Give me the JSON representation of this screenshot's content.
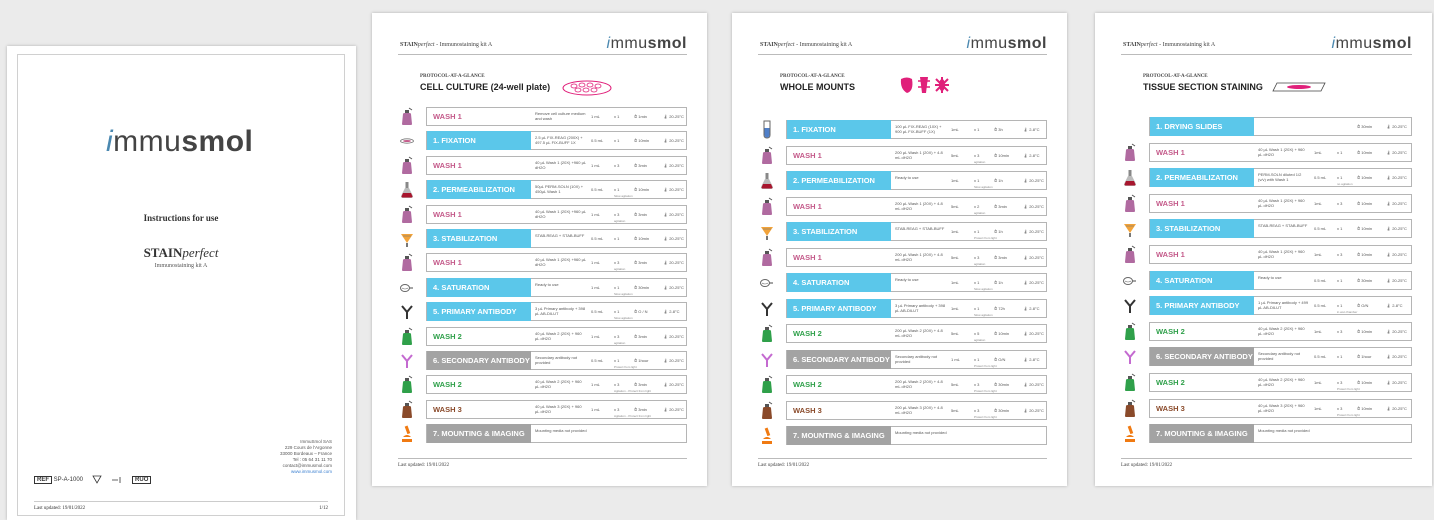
{
  "cover": {
    "logo_i": "i",
    "logo_mmu": "mmu",
    "logo_smol": "smol",
    "instructions": "Instructions for use",
    "brand_a": "STAIN",
    "brand_b": "perfect",
    "kit": "Immunostaining kit A",
    "address": [
      "ImmuSmol SAS",
      "229 Cours de l'Argonne",
      "33000 Bordeaux – France",
      "Tel : 05 64 31 11 70",
      "contact@immusmol.com",
      "www.immusmol.com"
    ],
    "ref_label": "REF",
    "ref_value": "SP-A-1000",
    "ruo": "RUO",
    "last_updated": "Last updated: 19/01/2022",
    "page_no": "1/12"
  },
  "header": {
    "brand_a": "STAIN",
    "brand_b": "perfect",
    "kit": " - Immunostaining kit A",
    "glance": "PROTOCOL-AT-A-GLANCE",
    "last_updated": "Last updated: 19/01/2022"
  },
  "page1": {
    "title": "CELL CULTURE (24-well plate)",
    "rows": [
      {
        "kind": "wash",
        "icon": "wash-bottle-icon",
        "label": "WASH 1",
        "reagent": "Remove cell culture medium and wash",
        "vol": "1 mL",
        "rep": "x 1",
        "time": "1min",
        "temp": "20-25°C",
        "note": ""
      },
      {
        "kind": "step",
        "icon": "petri-dish-icon",
        "label": "1. FIXATION",
        "reagent": "2.5 µL FIX-REAG (200X) + 497.5 µL FIX-BUFF 1X",
        "vol": "0.5 mL",
        "rep": "x 1",
        "time": "10min",
        "temp": "20-25°C",
        "note": ""
      },
      {
        "kind": "wash",
        "icon": "wash-bottle-icon",
        "label": "WASH 1",
        "reagent": "40 µL Wash 1 (20X) +960 µL dH2O",
        "vol": "1 mL",
        "rep": "x 3",
        "time": "3min",
        "temp": "20-25°C",
        "note": ""
      },
      {
        "kind": "step",
        "icon": "flask-icon",
        "label": "2. PERMEABILIZATION",
        "reagent": "50µL PERM-SOLN (10X) + 450µL Wash 1",
        "vol": "0.5 mL",
        "rep": "x 1",
        "time": "10min",
        "temp": "20-25°C",
        "note": "Slow agitation"
      },
      {
        "kind": "wash",
        "icon": "wash-bottle-icon",
        "label": "WASH 1",
        "reagent": "40 µL Wash 1 (20X) +960 µL dH2O",
        "vol": "1 mL",
        "rep": "x 3",
        "time": "3min",
        "temp": "20-25°C",
        "note": "agitation"
      },
      {
        "kind": "step",
        "icon": "funnel-icon",
        "label": "3. STABILIZATION",
        "reagent": "STAB-REAG + STAB-BUFF",
        "vol": "0.5 mL",
        "rep": "x 1",
        "time": "10min",
        "temp": "20-25°C",
        "note": ""
      },
      {
        "kind": "wash",
        "icon": "wash-bottle-icon",
        "label": "WASH 1",
        "reagent": "40 µL Wash 1 (20X) +960 µL dH2O",
        "vol": "1 mL",
        "rep": "x 3",
        "time": "3min",
        "temp": "20-25°C",
        "note": "agitation"
      },
      {
        "kind": "step",
        "icon": "pipette-icon",
        "label": "4. SATURATION",
        "reagent": "Ready to use",
        "vol": "1 mL",
        "rep": "x 1",
        "time": "30min",
        "temp": "20-25°C",
        "note": "Slow agitation"
      },
      {
        "kind": "step",
        "icon": "antibody-icon",
        "label": "5. PRIMARY ANTIBODY",
        "reagent": "3 µL Primary antibody + 398 µL AB-DILUT",
        "vol": "0.5 mL",
        "rep": "x 1",
        "time": "O / N",
        "temp": "2-8°C",
        "note": "Slow agitation"
      },
      {
        "kind": "ab",
        "icon": "wash-bottle-icon",
        "label": "WASH 2",
        "reagent": "40 µL Wash 2 (20X) + 960 µL dH2O",
        "vol": "1 mL",
        "rep": "x 3",
        "time": "3min",
        "temp": "20-25°C",
        "note": "agitation"
      },
      {
        "kind": "sec",
        "icon": "antibody-icon",
        "label": "6. SECONDARY ANTIBODY",
        "reagent": "Secondary antibody not provided",
        "vol": "0.5 mL",
        "rep": "x 1",
        "time": "1hour",
        "temp": "20-25°C",
        "note": "Protect from light"
      },
      {
        "kind": "ab",
        "icon": "wash-bottle-icon",
        "label": "WASH 2",
        "reagent": "40 µL Wash 2 (20X) + 960 µL dH2O",
        "vol": "1 mL",
        "rep": "x 3",
        "time": "3min",
        "temp": "20-25°C",
        "note": "Agitation - Protect from light"
      },
      {
        "kind": "w3",
        "icon": "wash-bottle-icon",
        "label": "WASH 3",
        "reagent": "40 µL Wash 3 (20X) + 960 µL dH2O",
        "vol": "1 mL",
        "rep": "x 3",
        "time": "3min",
        "temp": "20-25°C",
        "note": "Agitation - Protect from light"
      },
      {
        "kind": "mount",
        "icon": "microscope-icon",
        "label": "7. MOUNTING & IMAGING",
        "reagent": "Mounting media not provided",
        "vol": "",
        "rep": "",
        "time": "",
        "temp": "",
        "note": ""
      }
    ]
  },
  "page2": {
    "title": "WHOLE MOUNTS",
    "rows": [
      {
        "kind": "step",
        "icon": "tube-icon",
        "label": "1. FIXATION",
        "reagent": "100 µL FIX-REAG (10X) + 900 µL FIX-BUFF (1X)",
        "vol": "1mL",
        "rep": "x 1",
        "time": "3h",
        "temp": "2-8°C",
        "note": ""
      },
      {
        "kind": "wash",
        "icon": "wash-bottle-icon",
        "label": "WASH 1",
        "reagent": "200 µL Wash 1 (20X) + 4.8 mL dH2O",
        "vol": "5mL",
        "rep": "x 3",
        "time": "10min",
        "temp": "2-8°C",
        "note": "agitation"
      },
      {
        "kind": "step",
        "icon": "flask-icon",
        "label": "2. PERMEABILIZATION",
        "reagent": "Ready to use",
        "vol": "1mL",
        "rep": "x 1",
        "time": "1h",
        "temp": "20-25°C",
        "note": "Slow agitation"
      },
      {
        "kind": "wash",
        "icon": "wash-bottle-icon",
        "label": "WASH 1",
        "reagent": "200 µL Wash 1 (20X) + 4.8 mL dH2O",
        "vol": "5mL",
        "rep": "x 2",
        "time": "3min",
        "temp": "20-25°C",
        "note": "agitation"
      },
      {
        "kind": "step",
        "icon": "funnel-icon",
        "label": "3. STABILIZATION",
        "reagent": "STAB-REAG + STAB-BUFF",
        "vol": "1mL",
        "rep": "x 1",
        "time": "1h",
        "temp": "20-25°C",
        "note": "Protect from light"
      },
      {
        "kind": "wash",
        "icon": "wash-bottle-icon",
        "label": "WASH 1",
        "reagent": "200 µL Wash 1 (20X) + 4.8 mL dH2O",
        "vol": "5mL",
        "rep": "x 3",
        "time": "3min",
        "temp": "20-25°C",
        "note": "agitation"
      },
      {
        "kind": "step",
        "icon": "pipette-icon",
        "label": "4. SATURATION",
        "reagent": "Ready to use",
        "vol": "1mL",
        "rep": "x 1",
        "time": "1h",
        "temp": "20-25°C",
        "note": "Slow agitation"
      },
      {
        "kind": "step",
        "icon": "antibody-icon",
        "label": "5. PRIMARY ANTIBODY",
        "reagent": "3 µL Primary antibody + 398 µL AB-DILUT",
        "vol": "1mL",
        "rep": "x 1",
        "time": "72h",
        "temp": "2-8°C",
        "note": "Slow agitation"
      },
      {
        "kind": "ab",
        "icon": "wash-bottle-icon",
        "label": "WASH 2",
        "reagent": "200 µL Wash 2 (20X) + 4.8 mL dH2O",
        "vol": "5mL",
        "rep": "x 5",
        "time": "10min",
        "temp": "20-25°C",
        "note": "agitation"
      },
      {
        "kind": "sec",
        "icon": "antibody-icon",
        "label": "6. SECONDARY ANTIBODY",
        "reagent": "Secondary antibody not provided",
        "vol": "1 mL",
        "rep": "x 1",
        "time": "O/N",
        "temp": "2-8°C",
        "note": "Protect from light"
      },
      {
        "kind": "ab",
        "icon": "wash-bottle-icon",
        "label": "WASH 2",
        "reagent": "200 µL Wash 2 (20X) + 4.8 mL dH2O",
        "vol": "5mL",
        "rep": "x 3",
        "time": "30min",
        "temp": "20-25°C",
        "note": "Protect from light"
      },
      {
        "kind": "w3",
        "icon": "wash-bottle-icon",
        "label": "WASH 3",
        "reagent": "200 µL Wash 3 (20X) + 4.8 mL dH2O",
        "vol": "5mL",
        "rep": "x 3",
        "time": "30min",
        "temp": "20-25°C",
        "note": "Protect from light"
      },
      {
        "kind": "mount",
        "icon": "microscope-icon",
        "label": "7. MOUNTING & IMAGING",
        "reagent": "Mounting media not provided",
        "vol": "",
        "rep": "",
        "time": "",
        "temp": "",
        "note": ""
      }
    ]
  },
  "page3": {
    "title": "TISSUE SECTION STAINING",
    "rows": [
      {
        "kind": "step",
        "icon": "",
        "label": "1. DRYING SLIDES",
        "reagent": "",
        "vol": "",
        "rep": "",
        "time": "30min",
        "temp": "20-25°C",
        "note": ""
      },
      {
        "kind": "wash",
        "icon": "wash-bottle-icon",
        "label": "WASH 1",
        "reagent": "40 µL Wash 1 (20X) + 960 µL dH2O",
        "vol": "1mL",
        "rep": "x 1",
        "time": "10min",
        "temp": "20-25°C",
        "note": ""
      },
      {
        "kind": "step",
        "icon": "flask-icon",
        "label": "2. PERMEABILIZATION",
        "reagent": "PERM-SOLN diluted 1/2 (v/v) with Wash 1",
        "vol": "0.5 mL",
        "rep": "x 1",
        "time": "10min",
        "temp": "20-25°C",
        "note": "no agitation"
      },
      {
        "kind": "wash",
        "icon": "wash-bottle-icon",
        "label": "WASH 1",
        "reagent": "40 µL Wash 1 (20X) + 960 µL dH2O",
        "vol": "1mL",
        "rep": "x 3",
        "time": "10min",
        "temp": "20-25°C",
        "note": ""
      },
      {
        "kind": "step",
        "icon": "funnel-icon",
        "label": "3. STABILIZATION",
        "reagent": "STAB-REAG + STAB-BUFF",
        "vol": "0.5 mL",
        "rep": "x 1",
        "time": "10min",
        "temp": "20-25°C",
        "note": ""
      },
      {
        "kind": "wash",
        "icon": "wash-bottle-icon",
        "label": "WASH 1",
        "reagent": "40 µL Wash 1 (20X) + 960 µL dH2O",
        "vol": "1mL",
        "rep": "x 3",
        "time": "10min",
        "temp": "20-25°C",
        "note": ""
      },
      {
        "kind": "step",
        "icon": "pipette-icon",
        "label": "4. SATURATION",
        "reagent": "Ready to use",
        "vol": "0.5 mL",
        "rep": "x 1",
        "time": "30min",
        "temp": "20-25°C",
        "note": ""
      },
      {
        "kind": "step",
        "icon": "antibody-icon",
        "label": "5. PRIMARY ANTIBODY",
        "reagent": "1 µL Primary antibody + 499 µL AB-DILUT",
        "vol": "0.5 mL",
        "rep": "x 1",
        "time": "O/N",
        "temp": "2-8°C",
        "note": "in wet chamber"
      },
      {
        "kind": "ab",
        "icon": "wash-bottle-icon",
        "label": "WASH 2",
        "reagent": "40 µL Wash 2 (20X) + 960 µL dH2O",
        "vol": "1mL",
        "rep": "x 3",
        "time": "10min",
        "temp": "20-25°C",
        "note": ""
      },
      {
        "kind": "sec",
        "icon": "antibody-icon",
        "label": "6. SECONDARY ANTIBODY",
        "reagent": "Secondary antibody not provided",
        "vol": "0.5 mL",
        "rep": "x 1",
        "time": "1hour",
        "temp": "20-25°C",
        "note": ""
      },
      {
        "kind": "ab",
        "icon": "wash-bottle-icon",
        "label": "WASH 2",
        "reagent": "40 µL Wash 2 (20X) + 960 µL dH2O",
        "vol": "1mL",
        "rep": "x 3",
        "time": "10min",
        "temp": "20-25°C",
        "note": "Protect from light"
      },
      {
        "kind": "w3",
        "icon": "wash-bottle-icon",
        "label": "WASH 3",
        "reagent": "40 µL Wash 3 (20X) + 960 µL dH2O",
        "vol": "1mL",
        "rep": "x 3",
        "time": "10min",
        "temp": "20-25°C",
        "note": "Protect from light"
      },
      {
        "kind": "mount",
        "icon": "microscope-icon",
        "label": "7. MOUNTING & IMAGING",
        "reagent": "Mounting media not provided",
        "vol": "",
        "rep": "",
        "time": "",
        "temp": "",
        "note": ""
      }
    ]
  },
  "colors": {
    "step_blue": "#5bc7ea",
    "grey_step": "#a3a3a3",
    "wash1_pink": "#c45a8a",
    "wash2_green": "#2fa04a",
    "wash3_brown": "#8a4a2a",
    "magenta_art": "#e0207a",
    "logo_accent": "#4a88b0"
  }
}
